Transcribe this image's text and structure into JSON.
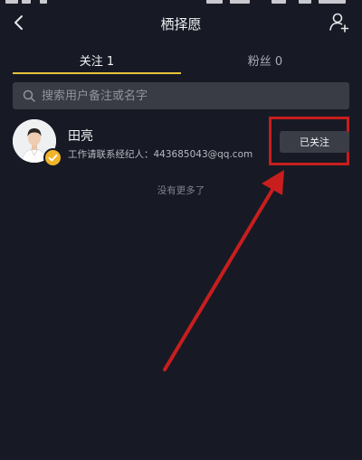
{
  "header": {
    "title": "栖择愿"
  },
  "tabs": [
    {
      "label": "关注 1",
      "active": true
    },
    {
      "label": "粉丝 0",
      "active": false
    }
  ],
  "search": {
    "placeholder": "搜索用户备注或名字",
    "value": ""
  },
  "users": [
    {
      "name": "田亮",
      "description": "工作请联系经纪人：443685043@qq.com",
      "verified": true,
      "follow_label": "已关注"
    }
  ],
  "list_end_text": "没有更多了",
  "icons": {
    "back": "back-arrow-icon",
    "add_user": "add-user-icon",
    "search": "search-icon",
    "verified": "verified-check-icon"
  },
  "colors": {
    "background": "#171a24",
    "tab_underline": "#e7c23a",
    "highlight": "#c81e1e",
    "verified_badge": "#f1b52c"
  }
}
